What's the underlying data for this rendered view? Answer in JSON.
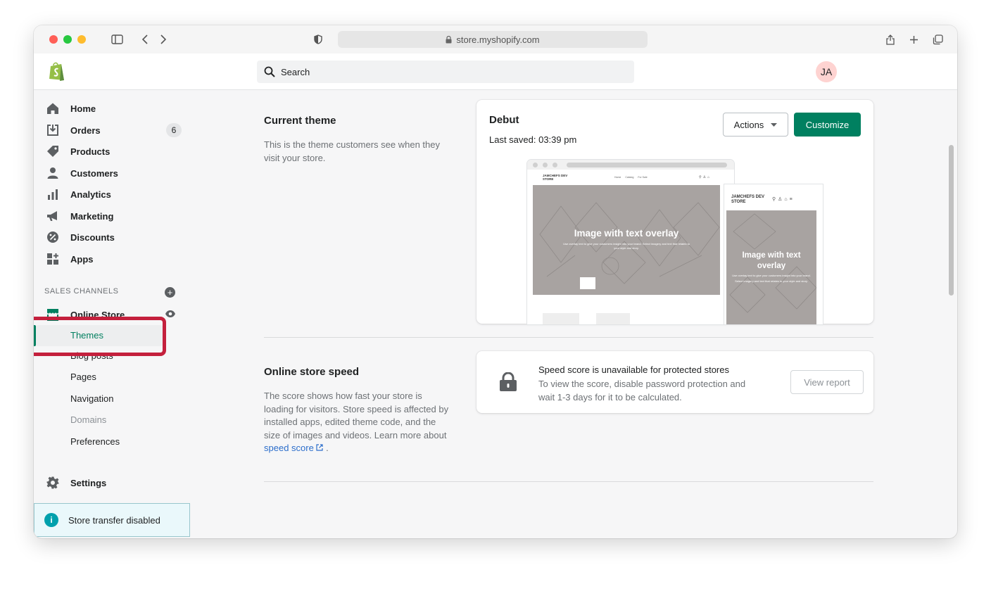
{
  "browser": {
    "url": "store.myshopify.com"
  },
  "topbar": {
    "search_placeholder": "Search",
    "avatar_initials": "JA"
  },
  "sidebar": {
    "items": [
      {
        "label": "Home",
        "icon": "home-icon"
      },
      {
        "label": "Orders",
        "icon": "orders-icon",
        "badge": "6"
      },
      {
        "label": "Products",
        "icon": "tag-icon"
      },
      {
        "label": "Customers",
        "icon": "person-icon"
      },
      {
        "label": "Analytics",
        "icon": "bar-chart-icon"
      },
      {
        "label": "Marketing",
        "icon": "megaphone-icon"
      },
      {
        "label": "Discounts",
        "icon": "discount-icon"
      },
      {
        "label": "Apps",
        "icon": "apps-icon"
      }
    ],
    "sales_channels_heading": "SALES CHANNELS",
    "online_store": {
      "label": "Online Store",
      "icon": "store-icon"
    },
    "online_store_sub": [
      {
        "label": "Themes",
        "active": true
      },
      {
        "label": "Blog posts"
      },
      {
        "label": "Pages"
      },
      {
        "label": "Navigation"
      },
      {
        "label": "Domains",
        "disabled": true
      },
      {
        "label": "Preferences"
      }
    ],
    "settings_label": "Settings",
    "banner_text": "Store transfer disabled"
  },
  "current_theme": {
    "title": "Current theme",
    "description": "This is the theme customers see when they visit your store.",
    "theme_name": "Debut",
    "last_saved": "Last saved: 03:39 pm",
    "actions_label": "Actions",
    "customize_label": "Customize",
    "preview": {
      "store_name_desktop": "JAMCHEFS DEV STORE",
      "store_name_mobile": "JAMCHEFS DEV STORE",
      "nav_links": [
        "Home",
        "Catalog",
        "For Sale"
      ],
      "hero_title": "Image with text overlay",
      "hero_body": "Use overlay text to give your customers insight into your brand. Select imagery and text that relates to your style and story."
    }
  },
  "speed": {
    "title": "Online store speed",
    "description_pre": "The score shows how fast your store is loading for visitors. Store speed is affected by installed apps, edited theme code, and the size of images and videos. Learn more about",
    "link_text": "speed score",
    "description_post": ".",
    "card_title": "Speed score is unavailable for protected stores",
    "card_body": "To view the score, disable password protection and wait 1-3 days for it to be calculated.",
    "view_report_label": "View report"
  },
  "colors": {
    "brand_green": "#008060",
    "highlight_red": "#c4203d",
    "link_blue": "#2c6ecb"
  }
}
